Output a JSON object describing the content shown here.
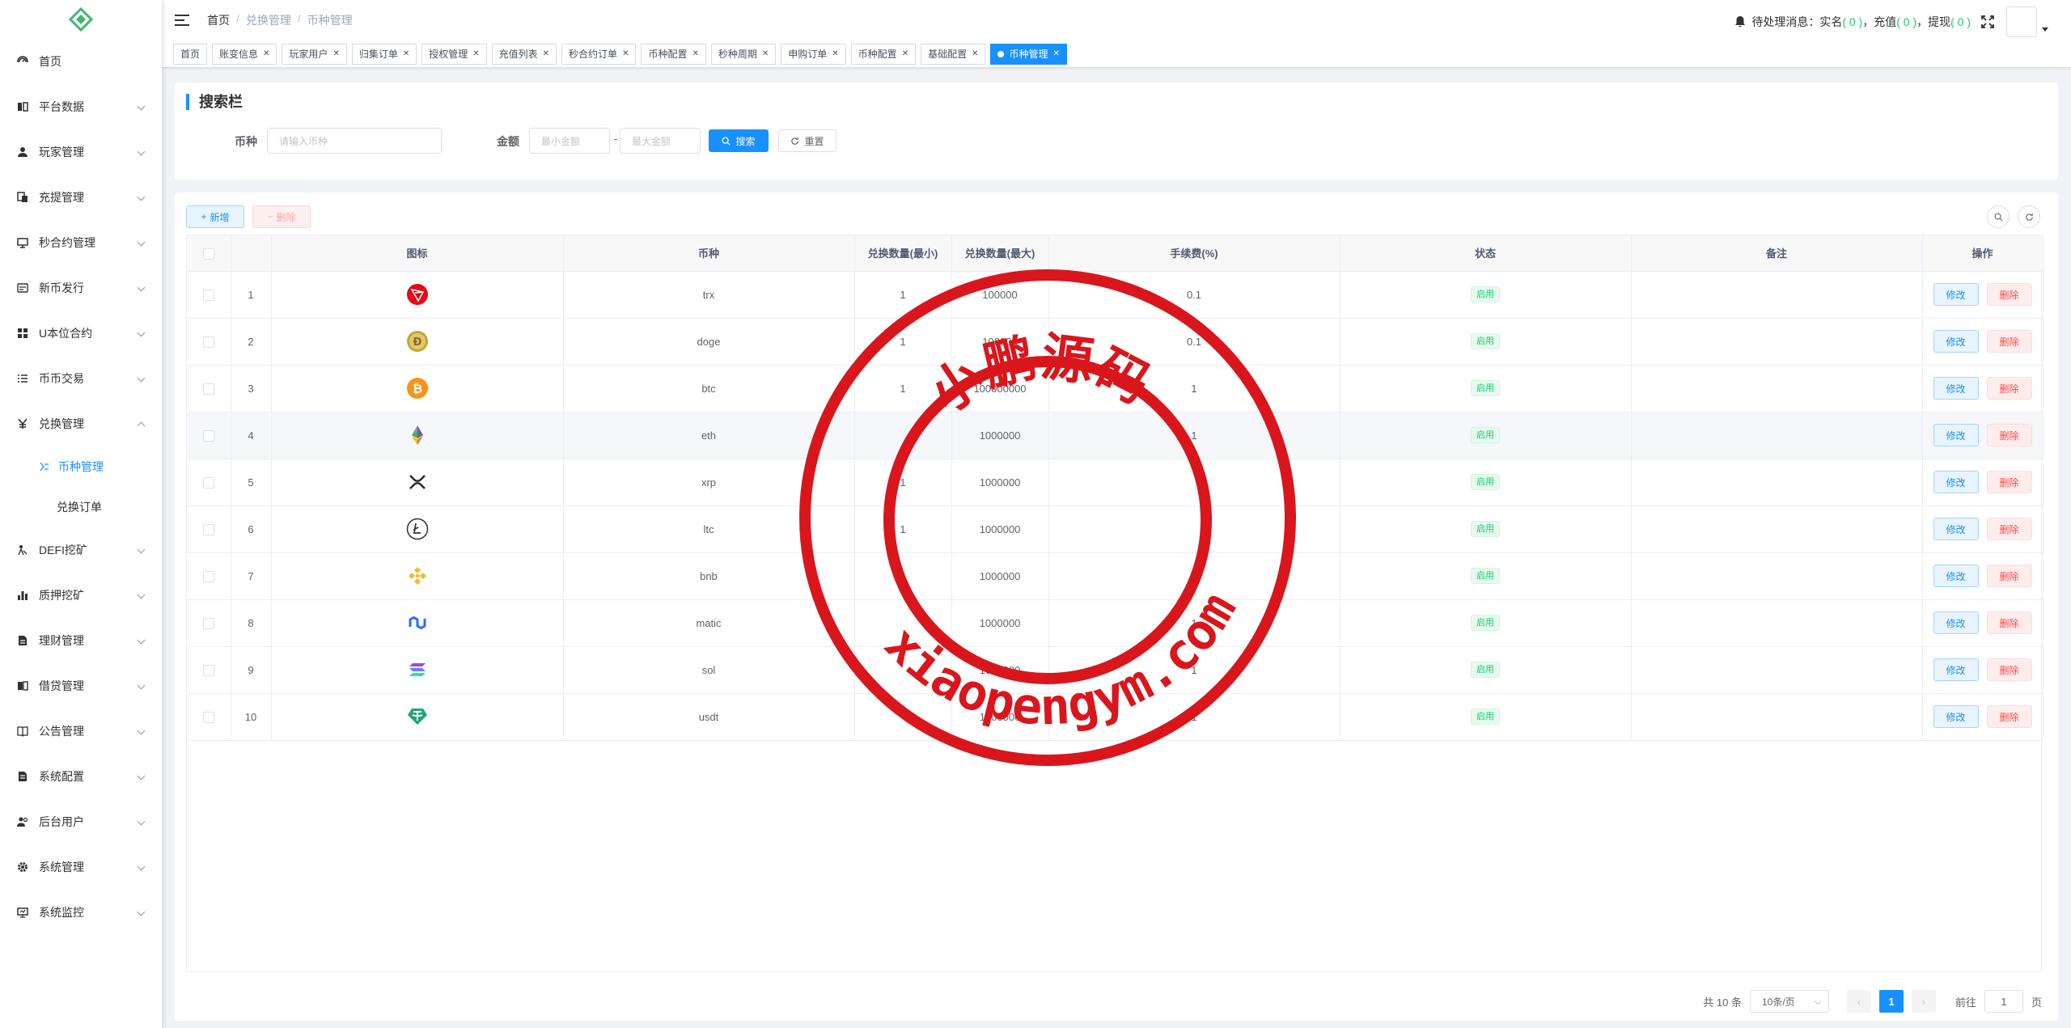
{
  "sidebar": {
    "items": [
      {
        "label": "首页",
        "icon": "dashboard-icon",
        "expandable": false
      },
      {
        "label": "平台数据",
        "icon": "data-icon",
        "expandable": true
      },
      {
        "label": "玩家管理",
        "icon": "user-icon",
        "expandable": true
      },
      {
        "label": "充提管理",
        "icon": "wallet-icon",
        "expandable": true
      },
      {
        "label": "秒合约管理",
        "icon": "monitor-icon",
        "expandable": true
      },
      {
        "label": "新币发行",
        "icon": "coin-icon",
        "expandable": true
      },
      {
        "label": "U本位合约",
        "icon": "grid-icon",
        "expandable": true
      },
      {
        "label": "币币交易",
        "icon": "list-icon",
        "expandable": true
      },
      {
        "label": "兑换管理",
        "icon": "yen-icon",
        "expandable": true,
        "open": true
      }
    ],
    "submenu": [
      {
        "label": "币种管理",
        "active": true
      },
      {
        "label": "兑换订单",
        "active": false
      }
    ],
    "items_after": [
      {
        "label": "DEFI挖矿",
        "icon": "miner-icon"
      },
      {
        "label": "质押挖矿",
        "icon": "chart-icon"
      },
      {
        "label": "理财管理",
        "icon": "doc-icon"
      },
      {
        "label": "借贷管理",
        "icon": "loan-icon"
      },
      {
        "label": "公告管理",
        "icon": "book-icon"
      },
      {
        "label": "系统配置",
        "icon": "config-icon"
      },
      {
        "label": "后台用户",
        "icon": "users-icon"
      },
      {
        "label": "系统管理",
        "icon": "gear-icon"
      },
      {
        "label": "系统监控",
        "icon": "monitor2-icon"
      }
    ]
  },
  "header": {
    "breadcrumb": [
      "首页",
      "兑换管理",
      "币种管理"
    ],
    "notice_prefix": "待处理消息：实名",
    "notice_realname": "( 0 )",
    "notice_recharge_label": "，充值",
    "notice_recharge": "( 0 )",
    "notice_withdraw_label": "，提现",
    "notice_withdraw": "( 0 )"
  },
  "tags": [
    {
      "label": "首页",
      "closable": false
    },
    {
      "label": "账变信息",
      "closable": true
    },
    {
      "label": "玩家用户",
      "closable": true
    },
    {
      "label": "归集订单",
      "closable": true
    },
    {
      "label": "授权管理",
      "closable": true
    },
    {
      "label": "充值列表",
      "closable": true
    },
    {
      "label": "秒合约订单",
      "closable": true
    },
    {
      "label": "币种配置",
      "closable": true
    },
    {
      "label": "秒种周期",
      "closable": true
    },
    {
      "label": "申购订单",
      "closable": true
    },
    {
      "label": "币种配置",
      "closable": true
    },
    {
      "label": "基础配置",
      "closable": true
    },
    {
      "label": "币种管理",
      "closable": true,
      "active": true
    }
  ],
  "search": {
    "title": "搜索栏",
    "coin_label": "币种",
    "coin_placeholder": "请输入币种",
    "amount_label": "金额",
    "min_placeholder": "最小金额",
    "dash": "-",
    "max_placeholder": "最大金额",
    "search_btn": "搜索",
    "reset_btn": "重置"
  },
  "toolbar": {
    "add_btn": "新增",
    "delete_btn": "删除"
  },
  "table": {
    "columns": [
      "",
      "",
      "图标",
      "币种",
      "兑换数量(最小)",
      "兑换数量(最大)",
      "手续费(%)",
      "状态",
      "备注",
      "操作"
    ],
    "rows": [
      {
        "idx": "1",
        "icon": "trx",
        "coin": "trx",
        "min": "1",
        "max": "100000",
        "fee": "0.1",
        "status": "启用"
      },
      {
        "idx": "2",
        "icon": "doge",
        "coin": "doge",
        "min": "1",
        "max": "100000",
        "fee": "0.1",
        "status": "启用"
      },
      {
        "idx": "3",
        "icon": "btc",
        "coin": "btc",
        "min": "1",
        "max": "100000000",
        "fee": "1",
        "status": "启用"
      },
      {
        "idx": "4",
        "icon": "eth",
        "coin": "eth",
        "min": "",
        "max": "1000000",
        "fee": "1",
        "status": "启用"
      },
      {
        "idx": "5",
        "icon": "xrp",
        "coin": "xrp",
        "min": "1",
        "max": "1000000",
        "fee": "",
        "status": "启用"
      },
      {
        "idx": "6",
        "icon": "ltc",
        "coin": "ltc",
        "min": "1",
        "max": "1000000",
        "fee": "",
        "status": "启用"
      },
      {
        "idx": "7",
        "icon": "bnb",
        "coin": "bnb",
        "min": "1",
        "max": "1000000",
        "fee": "",
        "status": "启用"
      },
      {
        "idx": "8",
        "icon": "matic",
        "coin": "matic",
        "min": "",
        "max": "1000000",
        "fee": "1",
        "status": "启用"
      },
      {
        "idx": "9",
        "icon": "sol",
        "coin": "sol",
        "min": "",
        "max": "1000000",
        "fee": "1",
        "status": "启用"
      },
      {
        "idx": "10",
        "icon": "usdt",
        "coin": "usdt",
        "min": "",
        "max": "1000000",
        "fee": "1",
        "status": "启用"
      }
    ],
    "edit_btn": "修改",
    "delete_btn": "删除"
  },
  "pagination": {
    "total": "共 10 条",
    "page_size": "10条/页",
    "current": "1",
    "goto_label": "前往",
    "goto_value": "1",
    "page_suffix": "页"
  },
  "watermark": {
    "cn": "小鹏源码",
    "url": "xiaopengym.com",
    "color": "#d9161c"
  }
}
